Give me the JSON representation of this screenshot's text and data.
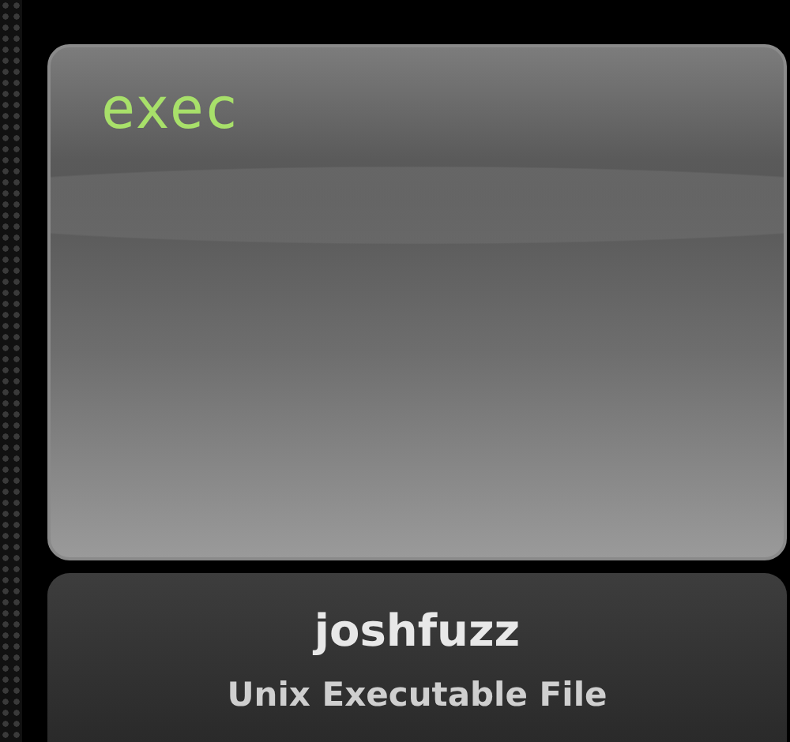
{
  "icon": {
    "label": "exec"
  },
  "file": {
    "name": "joshfuzz",
    "kind": "Unix Executable File"
  }
}
